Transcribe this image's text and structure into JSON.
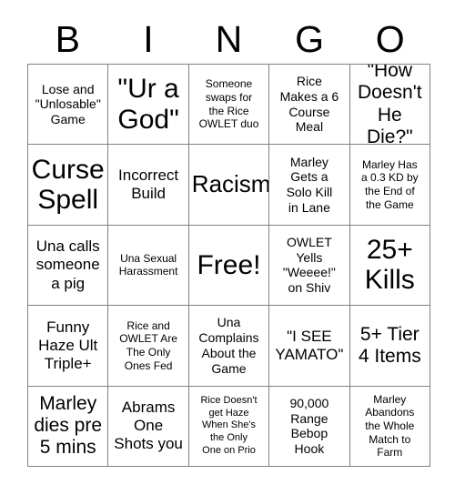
{
  "card": {
    "header_letters": [
      "B",
      "I",
      "N",
      "G",
      "O"
    ],
    "columns": 5,
    "rows": 5,
    "free_space_index": 12,
    "colors": {
      "background": "#ffffff",
      "text": "#000000",
      "grid_line": "#808080"
    },
    "cells": [
      {
        "text": "Lose and\n\"Unlosable\"\nGame",
        "size": "sm"
      },
      {
        "text": "\"Ur a\nGod\"",
        "size": "xxl"
      },
      {
        "text": "Someone\nswaps for\nthe Rice\nOWLET duo",
        "size": "xs"
      },
      {
        "text": "Rice\nMakes a 6\nCourse\nMeal",
        "size": "sm"
      },
      {
        "text": "\"How\nDoesn't\nHe Die?\"",
        "size": "lg"
      },
      {
        "text": "Curse\nSpell",
        "size": "xxl"
      },
      {
        "text": "Incorrect\nBuild",
        "size": "md"
      },
      {
        "text": "Racism",
        "size": "xl"
      },
      {
        "text": "Marley\nGets a\nSolo Kill\nin Lane",
        "size": "sm"
      },
      {
        "text": "Marley Has\na 0.3 KD by\nthe End of\nthe Game",
        "size": "xs"
      },
      {
        "text": "Una calls\nsomeone\na pig",
        "size": "md"
      },
      {
        "text": "Una Sexual\nHarassment",
        "size": "xs"
      },
      {
        "text": "Free!",
        "size": "xxl"
      },
      {
        "text": "OWLET\nYells\n\"Weeee!\"\non Shiv",
        "size": "sm"
      },
      {
        "text": "25+\nKills",
        "size": "xxl"
      },
      {
        "text": "Funny\nHaze Ult\nTriple+",
        "size": "md"
      },
      {
        "text": "Rice and\nOWLET Are\nThe Only\nOnes Fed",
        "size": "xs"
      },
      {
        "text": "Una\nComplains\nAbout the\nGame",
        "size": "sm"
      },
      {
        "text": "\"I SEE\nYAMATO\"",
        "size": "md"
      },
      {
        "text": "5+ Tier\n4 Items",
        "size": "lg"
      },
      {
        "text": "Marley\ndies pre\n5 mins",
        "size": "lg"
      },
      {
        "text": "Abrams\nOne\nShots you",
        "size": "md"
      },
      {
        "text": "Rice Doesn't\nget Haze\nWhen She's\nthe Only\nOne on Prio",
        "size": "xxs"
      },
      {
        "text": "90,000\nRange\nBebop\nHook",
        "size": "sm"
      },
      {
        "text": "Marley\nAbandons\nthe Whole\nMatch to\nFarm",
        "size": "xs"
      }
    ]
  }
}
